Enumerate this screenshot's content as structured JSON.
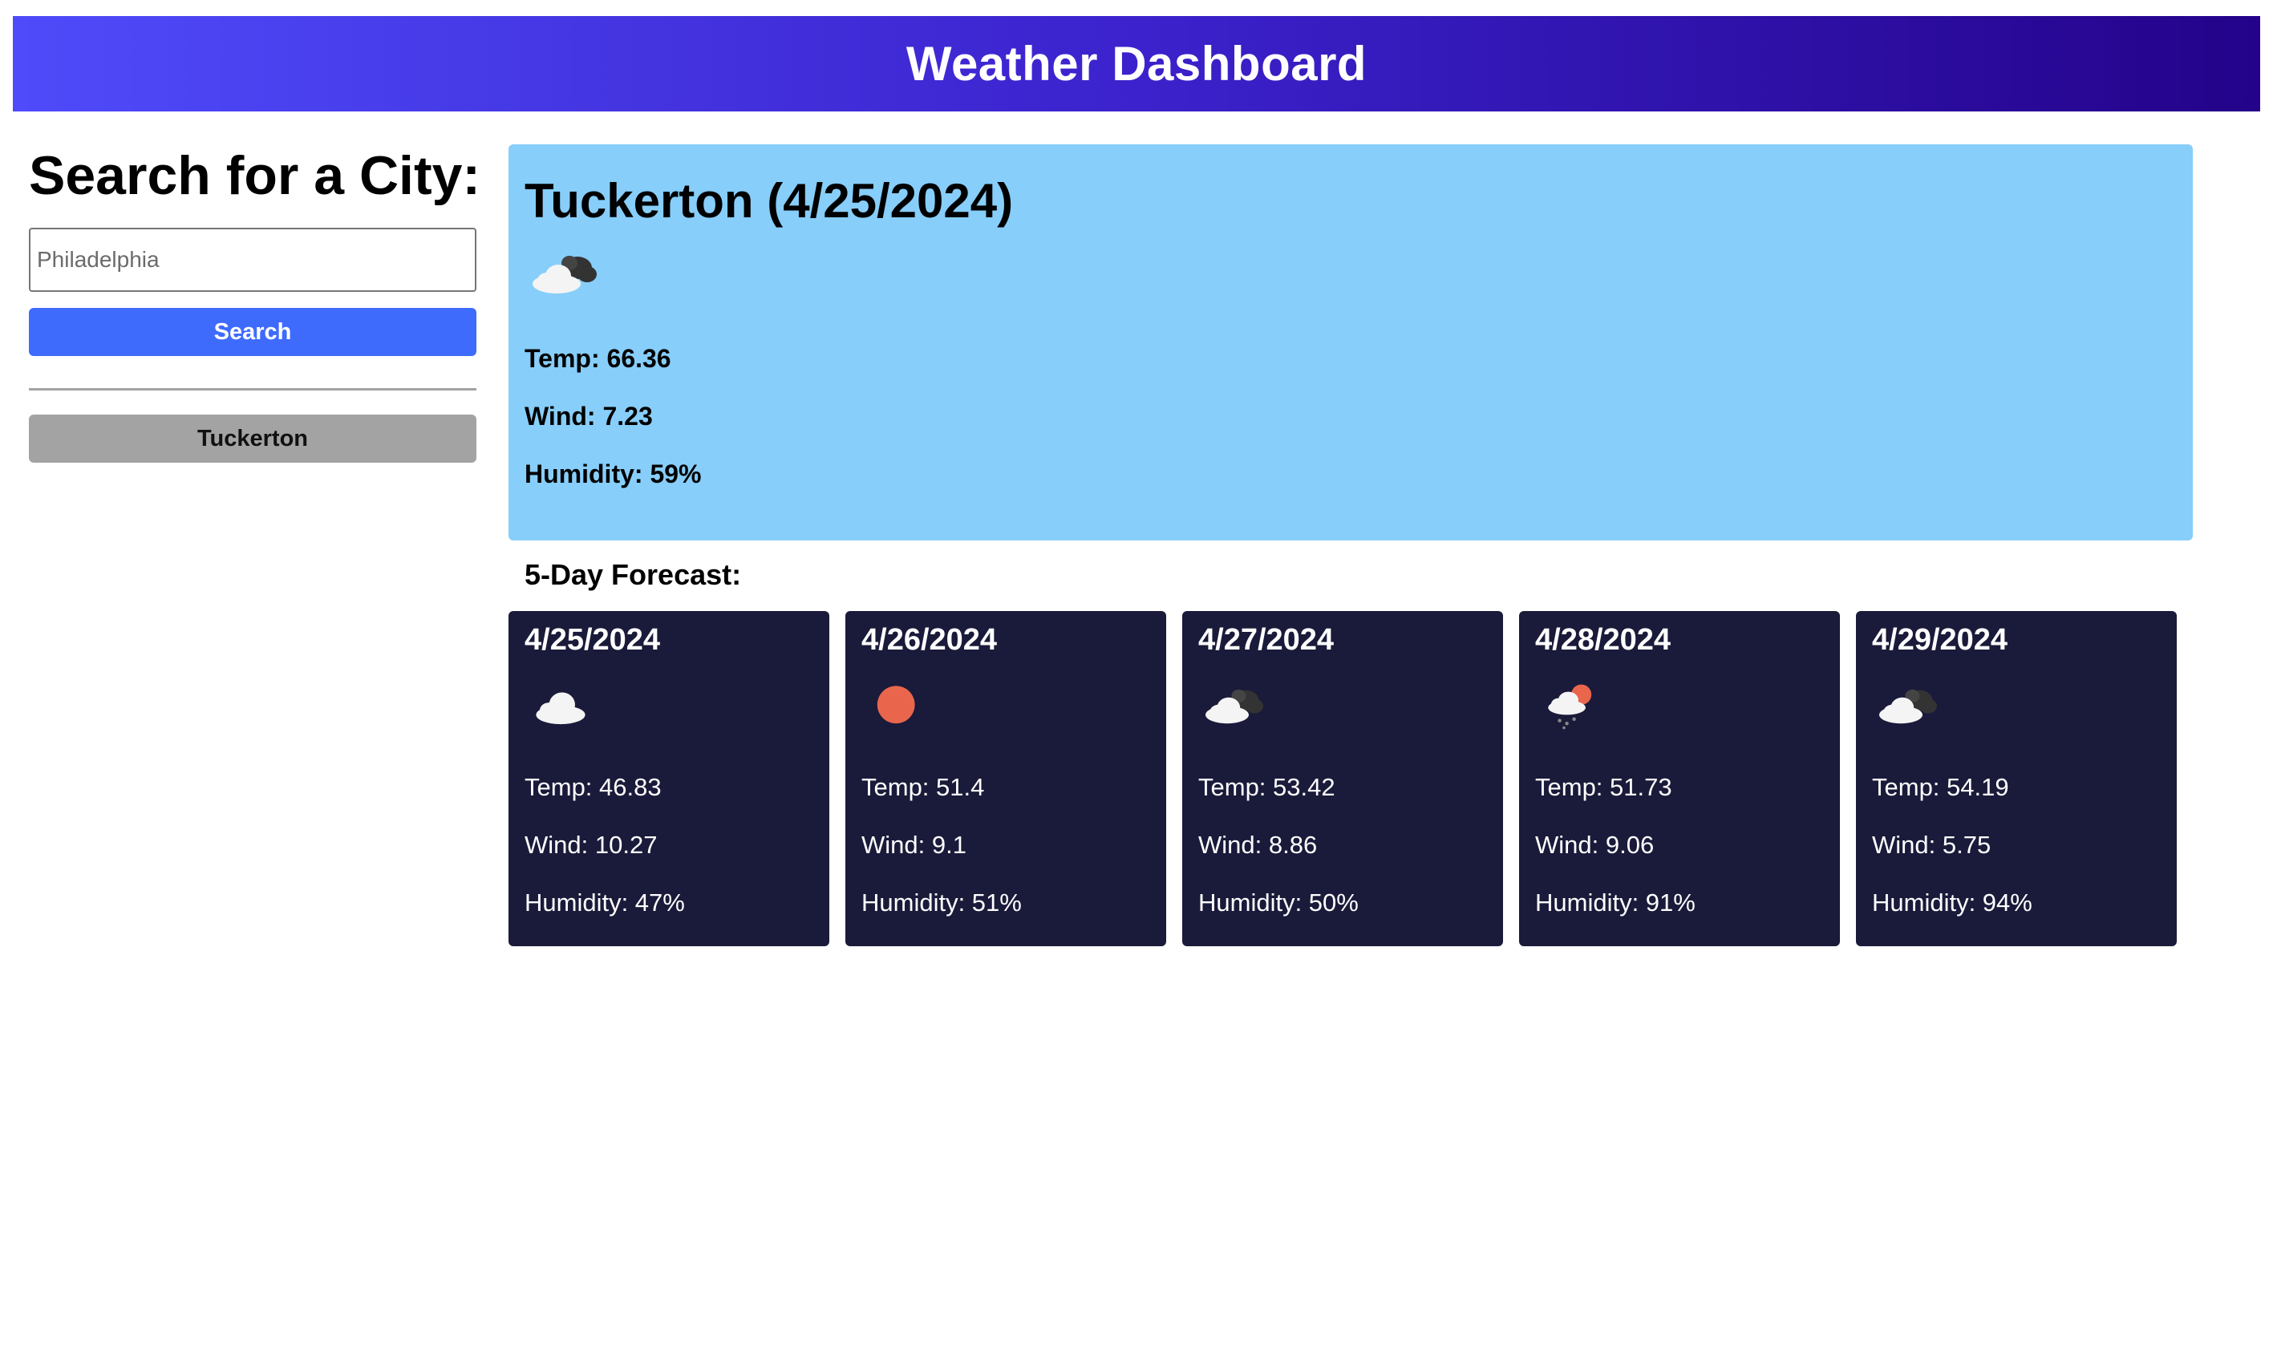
{
  "header": {
    "title": "Weather Dashboard"
  },
  "sidebar": {
    "heading": "Search for a City:",
    "search_placeholder": "Philadelphia",
    "search_button_label": "Search",
    "history": [
      "Tuckerton"
    ]
  },
  "current": {
    "title": "Tuckerton (4/25/2024)",
    "icon": "partly-cloudy-icon",
    "temp": "Temp: 66.36",
    "wind": "Wind: 7.23",
    "humidity": "Humidity: 59%"
  },
  "forecast": {
    "title": "5-Day Forecast:",
    "days": [
      {
        "date": "4/25/2024",
        "icon": "cloud-icon",
        "temp": "Temp: 46.83",
        "wind": "Wind: 10.27",
        "humidity": "Humidity: 47%"
      },
      {
        "date": "4/26/2024",
        "icon": "sun-icon",
        "temp": "Temp: 51.4",
        "wind": "Wind: 9.1",
        "humidity": "Humidity: 51%"
      },
      {
        "date": "4/27/2024",
        "icon": "partly-cloudy-icon",
        "temp": "Temp: 53.42",
        "wind": "Wind: 8.86",
        "humidity": "Humidity: 50%"
      },
      {
        "date": "4/28/2024",
        "icon": "rain-sun-icon",
        "temp": "Temp: 51.73",
        "wind": "Wind: 9.06",
        "humidity": "Humidity: 91%"
      },
      {
        "date": "4/29/2024",
        "icon": "partly-cloudy-icon",
        "temp": "Temp: 54.19",
        "wind": "Wind: 5.75",
        "humidity": "Humidity: 94%"
      }
    ]
  },
  "colors": {
    "header_gradient_start": "#4f4bfa",
    "header_gradient_end": "#24038a",
    "search_button": "#3f6bfd",
    "history_button": "#a3a3a3",
    "current_panel": "#87cefa",
    "forecast_card": "#1a1a3a",
    "sun": "#e9664c"
  }
}
